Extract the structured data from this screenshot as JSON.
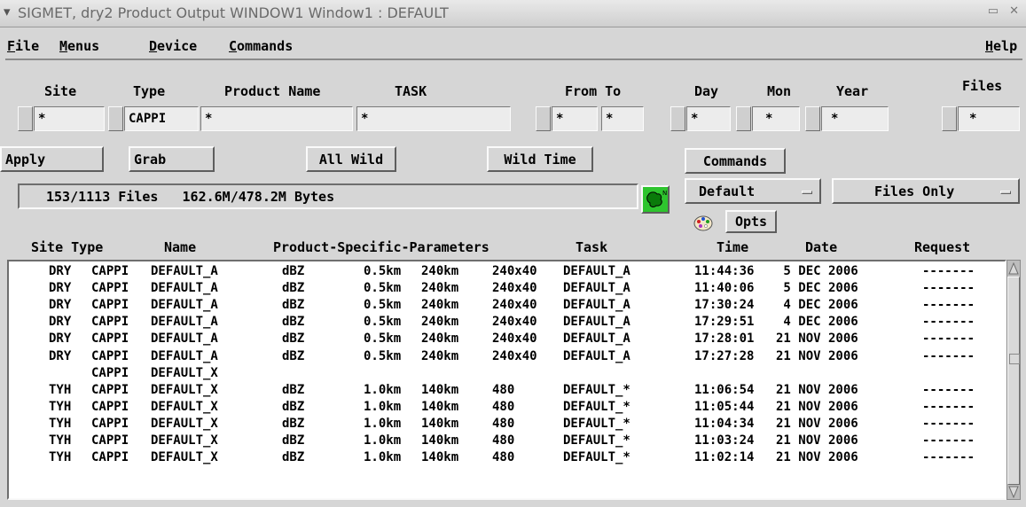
{
  "window": {
    "title": "SIGMET, dry2   Product Output WINDOW1 Window1 : DEFAULT",
    "controls": "▭ ✕"
  },
  "menubar": {
    "items": [
      {
        "first": "F",
        "rest": "ile"
      },
      {
        "first": "M",
        "rest": "enus"
      },
      {
        "first": "D",
        "rest": "evice"
      },
      {
        "first": "C",
        "rest": "ommands"
      }
    ],
    "help": {
      "first": "H",
      "rest": "elp"
    }
  },
  "filters": {
    "labels": {
      "site": "Site",
      "type": "Type",
      "product_name": "Product Name",
      "task": "TASK",
      "from_to": "From To",
      "day": "Day",
      "mon": "Mon",
      "year": "Year",
      "files": "Files"
    },
    "values": {
      "site": "*",
      "type": "CAPPI",
      "product_name": "*",
      "task": "*",
      "from": "*",
      "to": "*",
      "day": "*",
      "mon": "*",
      "year": "*",
      "files": "*"
    }
  },
  "buttons": {
    "apply": "Apply",
    "grab": "Grab",
    "all_wild": "All Wild",
    "wild_time": "Wild Time",
    "commands": "Commands",
    "default": "Default",
    "files_only": "Files Only",
    "opts": "Opts"
  },
  "status": {
    "files": "153/1113 Files",
    "bytes": "162.6M/478.2M Bytes"
  },
  "columns": {
    "site_type": "Site Type",
    "name": "Name",
    "params": "Product-Specific-Parameters",
    "task": "Task",
    "time": "Time",
    "date": "Date",
    "request": "Request"
  },
  "rows": [
    {
      "site": "DRY",
      "type": "CAPPI",
      "name": "DEFAULT_A",
      "unit": "dBZ",
      "p1": "0.5km",
      "p2": "240km",
      "p3": "240x40",
      "task": "DEFAULT_A",
      "time": "11:44:36",
      "date": " 5 DEC 2006",
      "req": "-------"
    },
    {
      "site": "DRY",
      "type": "CAPPI",
      "name": "DEFAULT_A",
      "unit": "dBZ",
      "p1": "0.5km",
      "p2": "240km",
      "p3": "240x40",
      "task": "DEFAULT_A",
      "time": "11:40:06",
      "date": " 5 DEC 2006",
      "req": "-------"
    },
    {
      "site": "DRY",
      "type": "CAPPI",
      "name": "DEFAULT_A",
      "unit": "dBZ",
      "p1": "0.5km",
      "p2": "240km",
      "p3": "240x40",
      "task": "DEFAULT_A",
      "time": "17:30:24",
      "date": " 4 DEC 2006",
      "req": "-------"
    },
    {
      "site": "DRY",
      "type": "CAPPI",
      "name": "DEFAULT_A",
      "unit": "dBZ",
      "p1": "0.5km",
      "p2": "240km",
      "p3": "240x40",
      "task": "DEFAULT_A",
      "time": "17:29:51",
      "date": " 4 DEC 2006",
      "req": "-------"
    },
    {
      "site": "DRY",
      "type": "CAPPI",
      "name": "DEFAULT_A",
      "unit": "dBZ",
      "p1": "0.5km",
      "p2": "240km",
      "p3": "240x40",
      "task": "DEFAULT_A",
      "time": "17:28:01",
      "date": "21 NOV 2006",
      "req": "-------"
    },
    {
      "site": "DRY",
      "type": "CAPPI",
      "name": "DEFAULT_A",
      "unit": "dBZ",
      "p1": "0.5km",
      "p2": "240km",
      "p3": "240x40",
      "task": "DEFAULT_A",
      "time": "17:27:28",
      "date": "21 NOV 2006",
      "req": "-------"
    },
    {
      "site": "",
      "type": "CAPPI",
      "name": "DEFAULT_X",
      "unit": "",
      "p1": "",
      "p2": "",
      "p3": "",
      "task": "",
      "time": "",
      "date": "",
      "req": ""
    },
    {
      "site": "TYH",
      "type": "CAPPI",
      "name": "DEFAULT_X",
      "unit": "dBZ",
      "p1": "1.0km",
      "p2": "140km",
      "p3": "480",
      "task": "DEFAULT_*",
      "time": "11:06:54",
      "date": "21 NOV 2006",
      "req": "-------"
    },
    {
      "site": "TYH",
      "type": "CAPPI",
      "name": "DEFAULT_X",
      "unit": "dBZ",
      "p1": "1.0km",
      "p2": "140km",
      "p3": "480",
      "task": "DEFAULT_*",
      "time": "11:05:44",
      "date": "21 NOV 2006",
      "req": "-------"
    },
    {
      "site": "TYH",
      "type": "CAPPI",
      "name": "DEFAULT_X",
      "unit": "dBZ",
      "p1": "1.0km",
      "p2": "140km",
      "p3": "480",
      "task": "DEFAULT_*",
      "time": "11:04:34",
      "date": "21 NOV 2006",
      "req": "-------"
    },
    {
      "site": "TYH",
      "type": "CAPPI",
      "name": "DEFAULT_X",
      "unit": "dBZ",
      "p1": "1.0km",
      "p2": "140km",
      "p3": "480",
      "task": "DEFAULT_*",
      "time": "11:03:24",
      "date": "21 NOV 2006",
      "req": "-------"
    },
    {
      "site": "TYH",
      "type": "CAPPI",
      "name": "DEFAULT_X",
      "unit": "dBZ",
      "p1": "1.0km",
      "p2": "140km",
      "p3": "480",
      "task": "DEFAULT_*",
      "time": "11:02:14",
      "date": "21 NOV 2006",
      "req": "-------"
    }
  ],
  "icons": {
    "window_menu": "chevron-down-icon",
    "map": "map-icon",
    "palette": "palette-icon",
    "scroll_up": "scroll-up-arrow-icon",
    "scroll_down": "scroll-down-arrow-icon"
  }
}
